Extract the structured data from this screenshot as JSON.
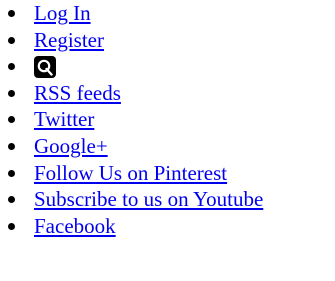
{
  "menu": {
    "items": [
      {
        "label": "Log In"
      },
      {
        "label": "Register"
      },
      {
        "label": "",
        "icon": "search-icon"
      },
      {
        "label": "RSS feeds"
      },
      {
        "label": "Twitter"
      },
      {
        "label": "Google+"
      },
      {
        "label": "Follow Us on Pinterest"
      },
      {
        "label": "Subscribe to us on Youtube"
      },
      {
        "label": "Facebook"
      }
    ]
  },
  "colors": {
    "link": "#0000ee",
    "text": "#000000",
    "background": "#ffffff"
  }
}
